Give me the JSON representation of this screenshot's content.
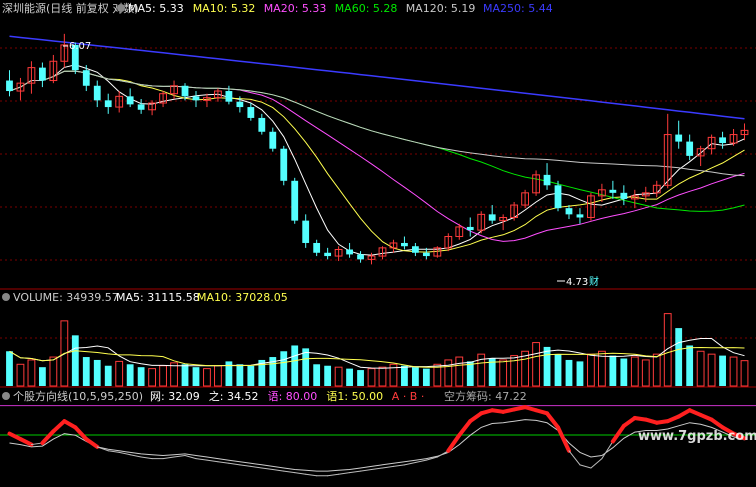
{
  "colors": {
    "background": "#000000",
    "up": "#ff3b3b",
    "down": "#54ffff",
    "ma5": "#ffffff",
    "ma10": "#ffff4f",
    "ma20": "#ff4fff",
    "ma60": "#00e800",
    "ma120": "#c8c8c8",
    "ma250": "#3b3bff",
    "grid": "#7a0000",
    "indicator_main": "#ff2020",
    "indicator_thin": "#cccccc",
    "indicator_level_green": "#00cc00",
    "indicator_level_magenta": "#cc33cc",
    "panel_label": "#cccccc"
  },
  "price_panel": {
    "title": "深圳能源(日线 前复权 对数)",
    "legend": [
      {
        "key": "MA5",
        "text": "MA5: 5.33",
        "color": "#ffffff"
      },
      {
        "key": "MA10",
        "text": "MA10: 5.32",
        "color": "#ffff4f"
      },
      {
        "key": "MA20",
        "text": "MA20: 5.33",
        "color": "#ff4fff"
      },
      {
        "key": "MA60",
        "text": "MA60: 5.28",
        "color": "#00e800"
      },
      {
        "key": "MA120",
        "text": "MA120: 5.19",
        "color": "#c8c8c8"
      },
      {
        "key": "MA250",
        "text": "MA250: 5.44",
        "color": "#3b3bff"
      }
    ],
    "high_label": "6.07",
    "low_label": "4.73",
    "low_tag": "财"
  },
  "volume_panel": {
    "title": "VOLUME: 34939.57",
    "ma5": "MA5: 31115.58",
    "ma10": "MA10: 37028.05"
  },
  "indicator_panel": {
    "title": "个股方向线(10,5,95,250)",
    "items": [
      {
        "text": "网: 32.09",
        "color": "#ffffff"
      },
      {
        "text": "之: 34.52",
        "color": "#ffffff"
      },
      {
        "text": "语: 80.00",
        "color": "#ff4fff"
      },
      {
        "text": "语1: 50.00",
        "color": "#ffff4f"
      },
      {
        "text": "A · B ·",
        "color": "#ff3b3b"
      },
      {
        "text": "空方筹码: 47.22",
        "color": "#aaaaaa"
      }
    ]
  },
  "watermark": "www.7gpzb.com",
  "chart_data": [
    {
      "type": "candlestick",
      "title": "深圳能源(日线 前复权 对数)",
      "ohlc": [
        [
          5.7,
          5.78,
          5.58,
          5.62
        ],
        [
          5.62,
          5.72,
          5.55,
          5.68
        ],
        [
          5.68,
          5.85,
          5.6,
          5.8
        ],
        [
          5.8,
          5.84,
          5.65,
          5.7
        ],
        [
          5.7,
          5.9,
          5.68,
          5.85
        ],
        [
          5.85,
          6.07,
          5.8,
          5.98
        ],
        [
          5.98,
          6.0,
          5.75,
          5.78
        ],
        [
          5.78,
          5.82,
          5.62,
          5.66
        ],
        [
          5.66,
          5.7,
          5.5,
          5.55
        ],
        [
          5.55,
          5.6,
          5.45,
          5.5
        ],
        [
          5.5,
          5.62,
          5.46,
          5.58
        ],
        [
          5.58,
          5.64,
          5.5,
          5.52
        ],
        [
          5.52,
          5.56,
          5.45,
          5.48
        ],
        [
          5.48,
          5.55,
          5.44,
          5.53
        ],
        [
          5.53,
          5.62,
          5.5,
          5.6
        ],
        [
          5.6,
          5.7,
          5.56,
          5.66
        ],
        [
          5.66,
          5.68,
          5.55,
          5.58
        ],
        [
          5.58,
          5.62,
          5.5,
          5.55
        ],
        [
          5.55,
          5.6,
          5.5,
          5.57
        ],
        [
          5.57,
          5.64,
          5.54,
          5.62
        ],
        [
          5.62,
          5.66,
          5.52,
          5.54
        ],
        [
          5.54,
          5.58,
          5.46,
          5.5
        ],
        [
          5.5,
          5.53,
          5.4,
          5.42
        ],
        [
          5.42,
          5.45,
          5.3,
          5.32
        ],
        [
          5.32,
          5.35,
          5.18,
          5.2
        ],
        [
          5.2,
          5.22,
          4.95,
          4.98
        ],
        [
          4.98,
          5.0,
          4.7,
          4.72
        ],
        [
          4.72,
          4.76,
          4.55,
          4.58
        ],
        [
          4.58,
          4.6,
          4.5,
          4.52
        ],
        [
          4.52,
          4.55,
          4.48,
          4.5
        ],
        [
          4.5,
          4.56,
          4.47,
          4.54
        ],
        [
          4.54,
          4.58,
          4.49,
          4.51
        ],
        [
          4.51,
          4.53,
          4.46,
          4.48
        ],
        [
          4.48,
          4.52,
          4.45,
          4.5
        ],
        [
          4.5,
          4.56,
          4.48,
          4.55
        ],
        [
          4.55,
          4.6,
          4.52,
          4.58
        ],
        [
          4.58,
          4.62,
          4.54,
          4.56
        ],
        [
          4.56,
          4.58,
          4.5,
          4.52
        ],
        [
          4.52,
          4.55,
          4.48,
          4.5
        ],
        [
          4.5,
          4.56,
          4.49,
          4.55
        ],
        [
          4.55,
          4.64,
          4.53,
          4.62
        ],
        [
          4.62,
          4.7,
          4.6,
          4.68
        ],
        [
          4.68,
          4.74,
          4.62,
          4.66
        ],
        [
          4.66,
          4.78,
          4.64,
          4.76
        ],
        [
          4.76,
          4.82,
          4.7,
          4.72
        ],
        [
          4.72,
          4.76,
          4.66,
          4.74
        ],
        [
          4.74,
          4.84,
          4.72,
          4.82
        ],
        [
          4.82,
          4.92,
          4.8,
          4.9
        ],
        [
          4.9,
          5.05,
          4.88,
          5.02
        ],
        [
          5.02,
          5.1,
          4.92,
          4.95
        ],
        [
          4.95,
          4.98,
          4.78,
          4.8
        ],
        [
          4.8,
          4.82,
          4.73,
          4.76
        ],
        [
          4.76,
          4.8,
          4.7,
          4.74
        ],
        [
          4.74,
          4.9,
          4.72,
          4.88
        ],
        [
          4.88,
          4.96,
          4.84,
          4.92
        ],
        [
          4.92,
          4.98,
          4.86,
          4.9
        ],
        [
          4.9,
          4.95,
          4.82,
          4.86
        ],
        [
          4.86,
          4.92,
          4.8,
          4.88
        ],
        [
          4.88,
          4.94,
          4.84,
          4.9
        ],
        [
          4.9,
          4.98,
          4.87,
          4.95
        ],
        [
          4.95,
          5.45,
          4.93,
          5.3
        ],
        [
          5.3,
          5.4,
          5.2,
          5.25
        ],
        [
          5.25,
          5.3,
          5.12,
          5.15
        ],
        [
          5.15,
          5.22,
          5.08,
          5.2
        ],
        [
          5.2,
          5.3,
          5.16,
          5.28
        ],
        [
          5.28,
          5.32,
          5.2,
          5.24
        ],
        [
          5.24,
          5.34,
          5.22,
          5.3
        ],
        [
          5.3,
          5.38,
          5.26,
          5.33
        ]
      ],
      "ma_lines": [
        "MA5",
        "MA10",
        "MA20",
        "MA60",
        "MA120",
        "MA250"
      ],
      "annotations": [
        "6.07",
        "4.73"
      ]
    },
    {
      "type": "bar",
      "title": "VOLUME",
      "series": [
        {
          "values": [
            48,
            30,
            36,
            26,
            40,
            90,
            70,
            40,
            36,
            28,
            34,
            30,
            26,
            24,
            28,
            32,
            30,
            26,
            24,
            28,
            34,
            30,
            28,
            36,
            40,
            48,
            56,
            52,
            30,
            28,
            26,
            24,
            22,
            24,
            26,
            30,
            28,
            26,
            24,
            30,
            36,
            40,
            34,
            44,
            38,
            36,
            42,
            48,
            60,
            54,
            44,
            36,
            34,
            44,
            48,
            42,
            38,
            40,
            36,
            44,
            100,
            80,
            56,
            48,
            44,
            42,
            40,
            35
          ]
        }
      ]
    },
    {
      "type": "line",
      "title": "个股方向线(10,5,95,250)",
      "series": [
        {
          "values": [
            62,
            55,
            48,
            50,
            65,
            78,
            70,
            55,
            45,
            40,
            38,
            35,
            32,
            30,
            30,
            32,
            34,
            30,
            28,
            26,
            24,
            22,
            20,
            18,
            16,
            14,
            12,
            10,
            8,
            8,
            10,
            12,
            14,
            16,
            18,
            20,
            22,
            25,
            28,
            32,
            40,
            60,
            78,
            88,
            92,
            90,
            93,
            96,
            92,
            88,
            70,
            40,
            22,
            18,
            30,
            52,
            72,
            82,
            80,
            76,
            78,
            84,
            92,
            86,
            80,
            70,
            62,
            56
          ]
        },
        {
          "values": [
            50,
            48,
            45,
            46,
            55,
            62,
            60,
            52,
            45,
            42,
            40,
            38,
            36,
            35,
            34,
            35,
            36,
            34,
            32,
            30,
            28,
            26,
            24,
            22,
            20,
            18,
            16,
            15,
            14,
            14,
            15,
            16,
            18,
            20,
            22,
            24,
            26,
            28,
            30,
            33,
            38,
            48,
            60,
            70,
            75,
            76,
            78,
            80,
            79,
            76,
            66,
            50,
            38,
            32,
            34,
            44,
            56,
            64,
            66,
            66,
            68,
            72,
            76,
            74,
            70,
            64,
            58,
            54
          ]
        }
      ],
      "levels": [
        80,
        50
      ]
    }
  ]
}
